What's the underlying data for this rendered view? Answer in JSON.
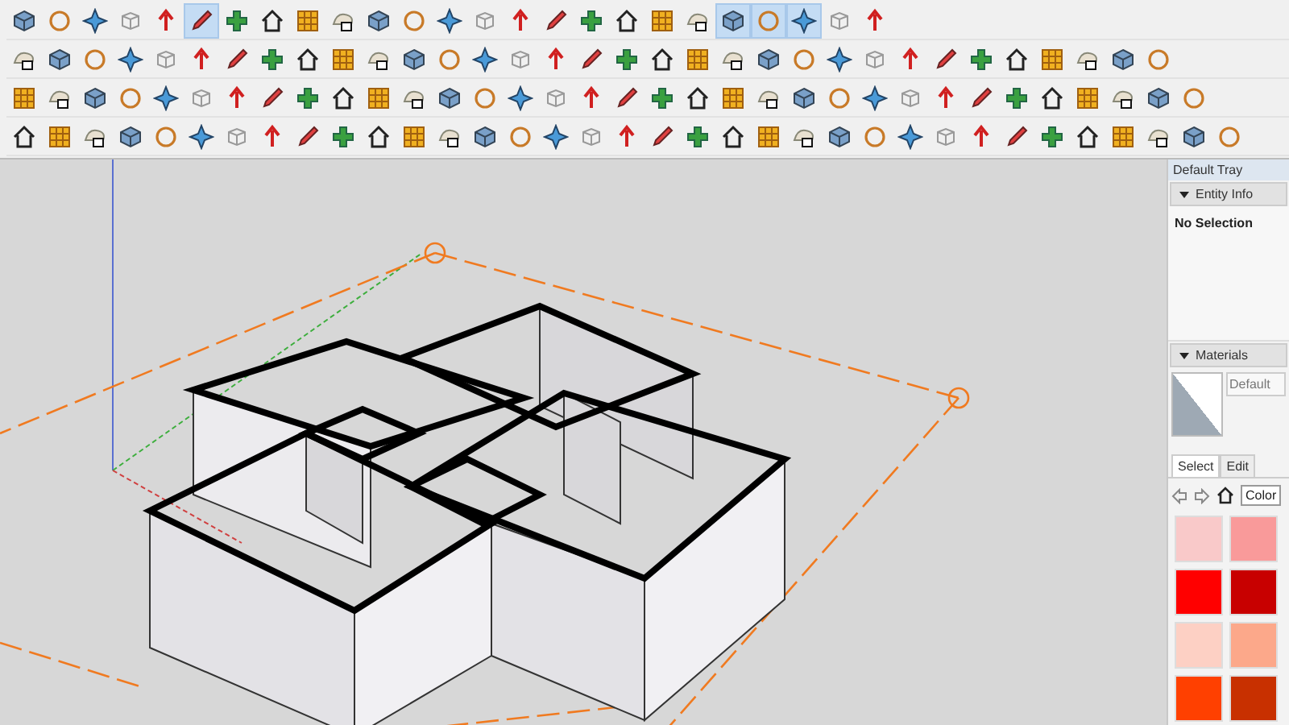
{
  "toolbars": [
    {
      "buttons": [
        {
          "selected": false
        },
        {
          "selected": false
        },
        {
          "selected": false
        },
        {
          "selected": false
        },
        {
          "selected": false
        },
        {
          "selected": true
        },
        {
          "selected": false
        },
        {
          "selected": false
        },
        {
          "selected": false
        },
        {
          "selected": false
        },
        {
          "selected": false
        },
        {
          "selected": false
        },
        {
          "selected": false
        },
        {
          "selected": false
        },
        {
          "selected": false
        },
        {
          "selected": false
        },
        {
          "selected": false
        },
        {
          "selected": false
        },
        {
          "selected": false
        },
        {
          "selected": false
        },
        {
          "selected": true
        },
        {
          "selected": true
        },
        {
          "selected": true
        },
        {
          "selected": false
        },
        {
          "selected": false
        }
      ]
    },
    {
      "buttons": [
        {
          "selected": false
        },
        {
          "selected": false
        },
        {
          "selected": false
        },
        {
          "selected": false
        },
        {
          "selected": false
        },
        {
          "selected": false
        },
        {
          "selected": false
        },
        {
          "selected": false
        },
        {
          "selected": false
        },
        {
          "selected": false
        },
        {
          "selected": false
        },
        {
          "selected": false
        },
        {
          "selected": false
        },
        {
          "selected": false
        },
        {
          "selected": false
        },
        {
          "selected": false
        },
        {
          "selected": false
        },
        {
          "selected": false
        },
        {
          "selected": false
        },
        {
          "selected": false
        },
        {
          "selected": false
        },
        {
          "selected": false
        },
        {
          "selected": false
        },
        {
          "selected": false
        },
        {
          "selected": false
        },
        {
          "selected": false
        },
        {
          "selected": false
        },
        {
          "selected": false
        },
        {
          "selected": false
        },
        {
          "selected": false
        },
        {
          "selected": false
        },
        {
          "selected": false
        },
        {
          "selected": false
        }
      ]
    },
    {
      "buttons": [
        {
          "selected": false
        },
        {
          "selected": false
        },
        {
          "selected": false
        },
        {
          "selected": false
        },
        {
          "selected": false
        },
        {
          "selected": false
        },
        {
          "selected": false
        },
        {
          "selected": false
        },
        {
          "selected": false
        },
        {
          "selected": false
        },
        {
          "selected": false
        },
        {
          "selected": false
        },
        {
          "selected": false
        },
        {
          "selected": false
        },
        {
          "selected": false
        },
        {
          "selected": false
        },
        {
          "selected": false
        },
        {
          "selected": false
        },
        {
          "selected": false
        },
        {
          "selected": false
        },
        {
          "selected": false
        },
        {
          "selected": false
        },
        {
          "selected": false
        },
        {
          "selected": false
        },
        {
          "selected": false
        },
        {
          "selected": false
        },
        {
          "selected": false
        },
        {
          "selected": false
        },
        {
          "selected": false
        },
        {
          "selected": false
        },
        {
          "selected": false
        },
        {
          "selected": false
        },
        {
          "selected": false
        },
        {
          "selected": false
        }
      ]
    },
    {
      "buttons": [
        {
          "selected": false
        },
        {
          "selected": false
        },
        {
          "selected": false
        },
        {
          "selected": false
        },
        {
          "selected": false
        },
        {
          "selected": false
        },
        {
          "selected": false
        },
        {
          "selected": false
        },
        {
          "selected": false
        },
        {
          "selected": false
        },
        {
          "selected": false
        },
        {
          "selected": false
        },
        {
          "selected": false
        },
        {
          "selected": false
        },
        {
          "selected": false
        },
        {
          "selected": false
        },
        {
          "selected": false
        },
        {
          "selected": false
        },
        {
          "selected": false
        },
        {
          "selected": false
        },
        {
          "selected": false
        },
        {
          "selected": false
        },
        {
          "selected": false
        },
        {
          "selected": false
        },
        {
          "selected": false
        },
        {
          "selected": false
        },
        {
          "selected": false
        },
        {
          "selected": false
        },
        {
          "selected": false
        },
        {
          "selected": false
        },
        {
          "selected": false
        },
        {
          "selected": false
        },
        {
          "selected": false
        },
        {
          "selected": false
        },
        {
          "selected": false
        }
      ]
    }
  ],
  "tray": {
    "title": "Default Tray",
    "entity_info": {
      "header": "Entity Info",
      "expanded": true,
      "selection": "No Selection"
    },
    "materials": {
      "header": "Materials",
      "expanded": true,
      "material_name": "Default",
      "tabs": [
        {
          "label": "Select",
          "selected": true
        },
        {
          "label": "Edit",
          "selected": false
        }
      ],
      "library": "Color",
      "swatches": [
        {
          "color": "#f9c9c9"
        },
        {
          "color": "#f99a9a"
        },
        {
          "color": "#ff0000"
        },
        {
          "color": "#c80000"
        },
        {
          "color": "#fdd0c4"
        },
        {
          "color": "#fca88a"
        },
        {
          "color": "#ff4000"
        },
        {
          "color": "#c83000"
        }
      ]
    }
  }
}
